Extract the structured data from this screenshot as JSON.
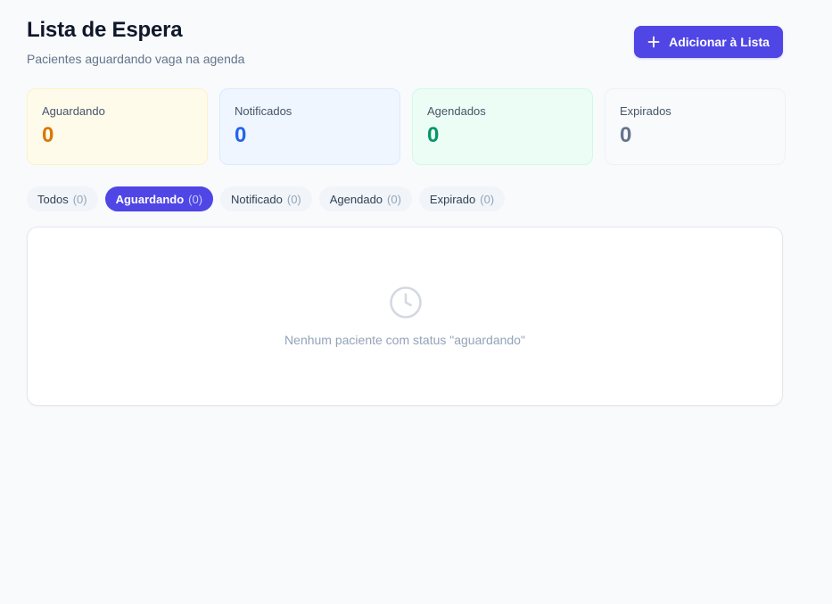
{
  "header": {
    "title": "Lista de Espera",
    "subtitle": "Pacientes aguardando vaga na agenda"
  },
  "actions": {
    "add_label": "Adicionar à Lista",
    "add_icon": "plus-icon"
  },
  "stats": [
    {
      "label": "Aguardando",
      "value": "0",
      "color": "#d97706",
      "bg": "#fffbeb",
      "border": "#fdf2c7"
    },
    {
      "label": "Notificados",
      "value": "0",
      "color": "#2563eb",
      "bg": "#eff6ff",
      "border": "#dbeafe"
    },
    {
      "label": "Agendados",
      "value": "0",
      "color": "#059669",
      "bg": "#ecfdf5",
      "border": "#d1fae5"
    },
    {
      "label": "Expirados",
      "value": "0",
      "color": "#64748b",
      "bg": "#f8fafc",
      "border": "#eef2f6"
    }
  ],
  "filters": [
    {
      "label": "Todos",
      "count": "(0)",
      "active": false
    },
    {
      "label": "Aguardando",
      "count": "(0)",
      "active": true
    },
    {
      "label": "Notificado",
      "count": "(0)",
      "active": false
    },
    {
      "label": "Agendado",
      "count": "(0)",
      "active": false
    },
    {
      "label": "Expirado",
      "count": "(0)",
      "active": false
    }
  ],
  "empty_state": {
    "icon": "clock-icon",
    "message": "Nenhum paciente com status \"aguardando\""
  },
  "colors": {
    "accent": "#4f46e5",
    "background": "#f8fafc"
  }
}
